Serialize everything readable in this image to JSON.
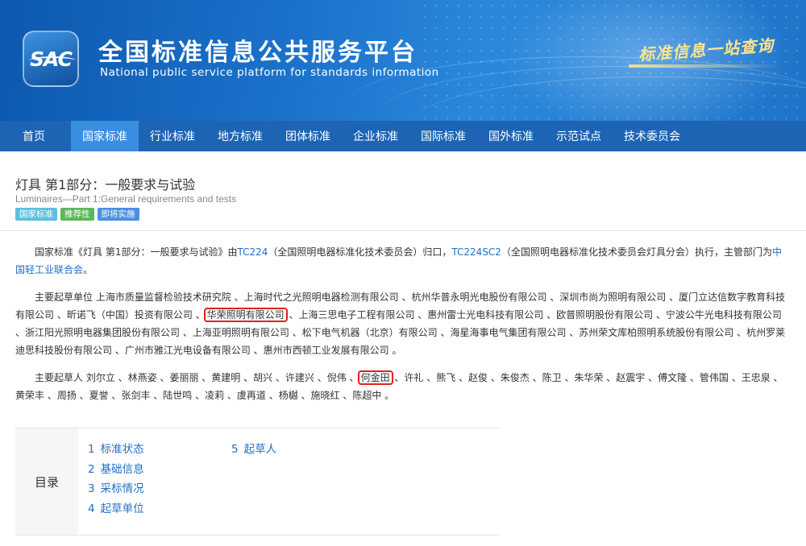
{
  "header": {
    "logo_text": "SAC",
    "title": "全国标准信息公共服务平台",
    "subtitle": "National public service platform  for standards information",
    "slogan": "标准信息一站查询"
  },
  "nav": {
    "items": [
      "首页",
      "国家标准",
      "行业标准",
      "地方标准",
      "团体标准",
      "企业标准",
      "国际标准",
      "国外标准",
      "示范试点",
      "技术委员会"
    ],
    "active_index": 1
  },
  "standard": {
    "title": "灯具 第1部分：一般要求与试验",
    "english_title": "Luminaires—Part 1:General requirements and tests",
    "badges": [
      "国家标准",
      "推荐性",
      "即将实施"
    ]
  },
  "intro": {
    "t1": "国家标准《灯具 第1部分：一般要求与试验》由",
    "link1": "TC224",
    "t2": "（全国照明电器标准化技术委员会）归口，",
    "link2": "TC224SC2",
    "t3": "（全国照明电器标准化技术委员会灯具分会）执行，主管部门为",
    "link3": "中国轻工业联合会",
    "t4": "。"
  },
  "drafting_units": {
    "label": "主要起草单位",
    "before": "上海市质量监督检验技术研究院 、上海时代之光照明电器检测有限公司 、杭州华普永明光电股份有限公司 、深圳市尚为照明有限公司 、厦门立达信数字教育科技有限公司 、昕诺飞（中国）投资有限公司 、",
    "highlighted": "华荣照明有限公司",
    "after": " 、上海三思电子工程有限公司 、惠州雷士光电科技有限公司 、欧普照明股份有限公司 、宁波公牛光电科技有限公司 、浙江阳光照明电器集团股份有限公司 、上海亚明照明有限公司 、松下电气机器（北京）有限公司 、海星海事电气集团有限公司 、苏州荣文库柏照明系统股份有限公司 、杭州罗莱迪思科技股份有限公司 、广州市雅江光电设备有限公司 、惠州市西顿工业发展有限公司 。"
  },
  "drafters": {
    "label": "主要起草人",
    "before": "刘尔立 、林燕姿 、姜丽丽 、黄建明 、胡兴 、许建兴 、倪伟 、",
    "highlighted": "何金田",
    "after": " 、许礼 、熊飞 、赵俊 、朱俊杰 、陈卫 、朱华荣 、赵震宇 、傅文隆 、管伟国 、王忠泉 、黄荣丰 、周扬 、夏誉 、张剑丰 、陆世鸣 、凌莉 、虞再道 、杨樾 、施晓红 、陈超中 。"
  },
  "toc": {
    "label": "目录",
    "col1": [
      {
        "num": "1",
        "text": "标准状态"
      },
      {
        "num": "2",
        "text": "基础信息"
      },
      {
        "num": "3",
        "text": "采标情况"
      },
      {
        "num": "4",
        "text": "起草单位"
      }
    ],
    "col2": [
      {
        "num": "5",
        "text": "起草人"
      }
    ]
  },
  "colors": {
    "banner": "#1c73cc",
    "nav": "#1e64b4",
    "nav_active": "#3a8ee0",
    "link": "#1f6fc6",
    "highlight_box": "#e0221a"
  }
}
